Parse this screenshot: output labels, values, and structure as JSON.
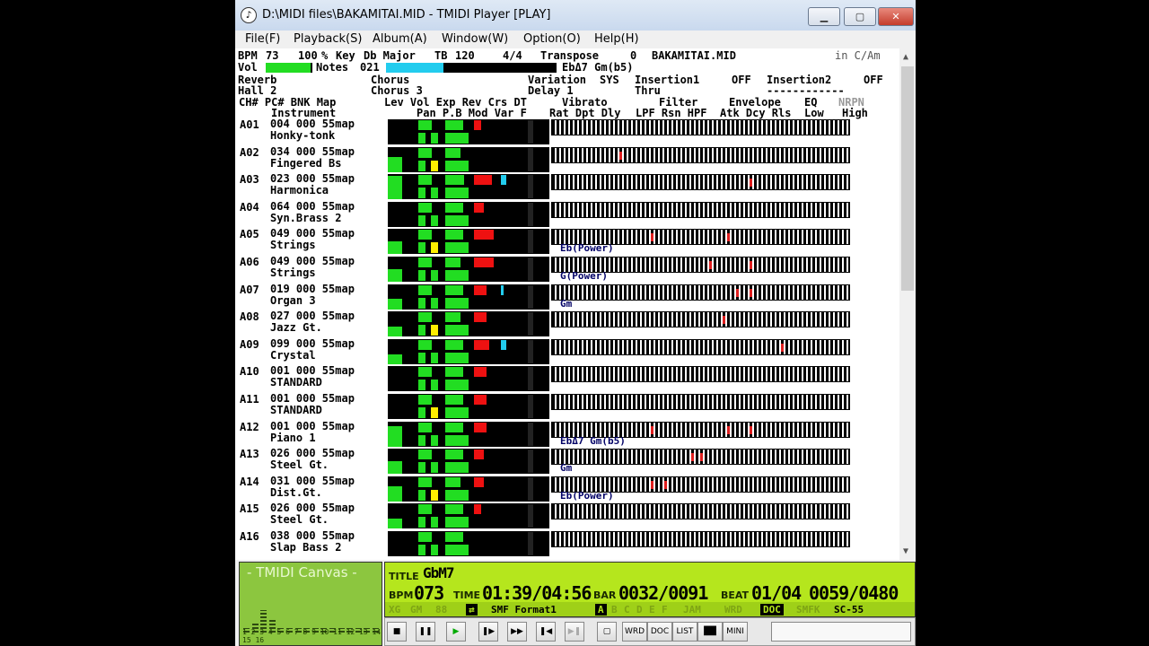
{
  "window": {
    "title": "D:\\MIDI files\\BAKAMITAI.MID - TMIDI Player [PLAY]",
    "min_glyph": "▁",
    "max_glyph": "▢",
    "close_glyph": "✕"
  },
  "menu": [
    "File(F)",
    "Playback(S)",
    "Album(A)",
    "Window(W)",
    "Option(O)",
    "Help(H)"
  ],
  "header": {
    "bpm_label": "BPM",
    "bpm": "73",
    "tempo_pct": "100",
    "tempo_unit": "%",
    "key_label": "Key",
    "key": "Db Major",
    "tb_label": "TB",
    "tb": "120",
    "time_sig": "4/4",
    "transpose_label": "Transpose",
    "transpose": "0",
    "file": "BAKAMITAI.MID",
    "key_mode": "in C/Am",
    "vol_label": "Vol",
    "notes_label": "Notes",
    "notes": "021",
    "chord": "EbΔ7 Gm(b5)",
    "reverb_label": "Reverb",
    "reverb": "Hall 2",
    "chorus_label": "Chorus",
    "chorus": "Chorus 3",
    "variation_label": "Variation",
    "sys_label": "SYS",
    "variation": "Delay 1",
    "insertion1_label": "Insertion1",
    "insertion1_state": "OFF",
    "insertion1": "Thru",
    "insertion2_label": "Insertion2",
    "insertion2_state": "OFF",
    "insertion2": "------------",
    "cols1": "CH#  PC#  BNK  Map",
    "cols1b": "Instrument",
    "cols2": "Lev  Vol  Exp  Rev  Crs  DT",
    "cols2b": "Pan  P.B  Mod  Var  F",
    "cols3": "Vibrato",
    "cols3b": "Rat  Dpt  Dly",
    "cols4": "Filter",
    "cols4b": "LPF  Rsn  HPF",
    "cols5": "Envelope",
    "cols5b": "Atk  Dcy  Rls",
    "cols6": "EQ",
    "cols6b": "Low",
    "nrpn": "NRPN",
    "high": "High"
  },
  "channels": [
    {
      "ch": "A01",
      "prog": "004 000 55map",
      "name": "Honky-tonk",
      "chord": "",
      "lev": 0.0,
      "vol": 0.55,
      "exp": 0.7,
      "rev": 0.3,
      "crs": 0.0,
      "hits": []
    },
    {
      "ch": "A02",
      "prog": "034 000 55map",
      "name": "Fingered Bs",
      "chord": "",
      "lev": 0.6,
      "vol": 0.55,
      "exp": 0.6,
      "rev": 0.0,
      "crs": 0.0,
      "hits": [
        75
      ]
    },
    {
      "ch": "A03",
      "prog": "023 000 55map",
      "name": "Harmonica",
      "chord": "",
      "lev": 0.95,
      "vol": 0.55,
      "exp": 0.75,
      "rev": 0.7,
      "crs": 0.2,
      "hits": [
        220
      ]
    },
    {
      "ch": "A04",
      "prog": "064 000 55map",
      "name": "Syn.Brass 2",
      "chord": "",
      "lev": 0.0,
      "vol": 0.55,
      "exp": 0.7,
      "rev": 0.4,
      "crs": 0.0,
      "hits": []
    },
    {
      "ch": "A05",
      "prog": "049 000 55map",
      "name": "Strings",
      "chord": "Eb(Power)",
      "lev": 0.5,
      "vol": 0.55,
      "exp": 0.7,
      "rev": 0.8,
      "crs": 0.0,
      "hits": [
        110,
        195
      ]
    },
    {
      "ch": "A06",
      "prog": "049 000 55map",
      "name": "Strings",
      "chord": "G(Power)",
      "lev": 0.5,
      "vol": 0.55,
      "exp": 0.6,
      "rev": 0.8,
      "crs": 0.0,
      "hits": [
        175,
        220
      ]
    },
    {
      "ch": "A07",
      "prog": "019 000 55map",
      "name": "Organ 3",
      "chord": "Gm",
      "lev": 0.4,
      "vol": 0.55,
      "exp": 0.7,
      "rev": 0.5,
      "crs": 0.1,
      "hits": [
        205,
        220
      ]
    },
    {
      "ch": "A08",
      "prog": "027 000 55map",
      "name": "Jazz Gt.",
      "chord": "",
      "lev": 0.4,
      "vol": 0.55,
      "exp": 0.6,
      "rev": 0.5,
      "crs": 0.0,
      "hits": [
        190
      ]
    },
    {
      "ch": "A09",
      "prog": "099 000 55map",
      "name": "Crystal",
      "chord": "",
      "lev": 0.4,
      "vol": 0.55,
      "exp": 0.7,
      "rev": 0.6,
      "crs": 0.2,
      "hits": [
        255
      ]
    },
    {
      "ch": "A10",
      "prog": "001 000 55map",
      "name": "STANDARD",
      "chord": "",
      "lev": 0.0,
      "vol": 0.55,
      "exp": 0.7,
      "rev": 0.5,
      "crs": 0.0,
      "hits": []
    },
    {
      "ch": "A11",
      "prog": "001 000 55map",
      "name": "STANDARD",
      "chord": "",
      "lev": 0.0,
      "vol": 0.55,
      "exp": 0.7,
      "rev": 0.5,
      "crs": 0.0,
      "hits": []
    },
    {
      "ch": "A12",
      "prog": "001 000 55map",
      "name": "Piano 1",
      "chord": "EbΔ7 Gm(b5)",
      "lev": 0.8,
      "vol": 0.55,
      "exp": 0.7,
      "rev": 0.5,
      "crs": 0.0,
      "hits": [
        110,
        195,
        220
      ]
    },
    {
      "ch": "A13",
      "prog": "026 000 55map",
      "name": "Steel Gt.",
      "chord": "Gm",
      "lev": 0.5,
      "vol": 0.55,
      "exp": 0.7,
      "rev": 0.4,
      "crs": 0.0,
      "hits": [
        155,
        165
      ]
    },
    {
      "ch": "A14",
      "prog": "031 000 55map",
      "name": "Dist.Gt.",
      "chord": "Eb(Power)",
      "lev": 0.6,
      "vol": 0.55,
      "exp": 0.6,
      "rev": 0.4,
      "crs": 0.0,
      "hits": [
        110,
        125
      ]
    },
    {
      "ch": "A15",
      "prog": "026 000 55map",
      "name": "Steel Gt.",
      "chord": "",
      "lev": 0.4,
      "vol": 0.55,
      "exp": 0.7,
      "rev": 0.3,
      "crs": 0.0,
      "hits": []
    },
    {
      "ch": "A16",
      "prog": "038 000 55map",
      "name": "Slap Bass 2",
      "chord": "",
      "lev": 0.0,
      "vol": 0.55,
      "exp": 0.7,
      "rev": 0.0,
      "crs": 0.0,
      "hits": []
    }
  ],
  "canvas": {
    "title": "- TMIDI Canvas -",
    "channel_numbers": "1 2 3 4 5 6 7 8 9 10 11 12 13 14 15 16",
    "levels": [
      0.1,
      0.2,
      0.5,
      0.3,
      0.1,
      0.1,
      0.1,
      0.1,
      0.1,
      0.1,
      0.1,
      0.1,
      0.1,
      0.1,
      0.1,
      0.1
    ]
  },
  "lcd": {
    "title_label": "TITLE",
    "title": "GbM7",
    "bpm_label": "BPM",
    "bpm": "073",
    "time_label": "TIME",
    "time": "01:39/04:56",
    "bar_label": "BAR",
    "bar": "0032/0091",
    "beat_label": "BEAT",
    "beat": "01/04",
    "tick": "0059/0480",
    "format": "SMF Format1",
    "module": "SC-55",
    "ports": [
      "A",
      "B",
      "C",
      "D",
      "E",
      "F"
    ],
    "flags": [
      "XG",
      "GM",
      "88",
      "JAM",
      "WRD",
      "DOC",
      "SMFK"
    ]
  },
  "toolbar": {
    "wrd": "WRD",
    "doc": "DOC",
    "list": "LIST",
    "mini": "MINI"
  },
  "colors": {
    "green": "#22dd22",
    "yellow": "#ffee00",
    "red": "#ee1111",
    "cyan": "#22ccee",
    "lcd": "#b5e61d"
  }
}
